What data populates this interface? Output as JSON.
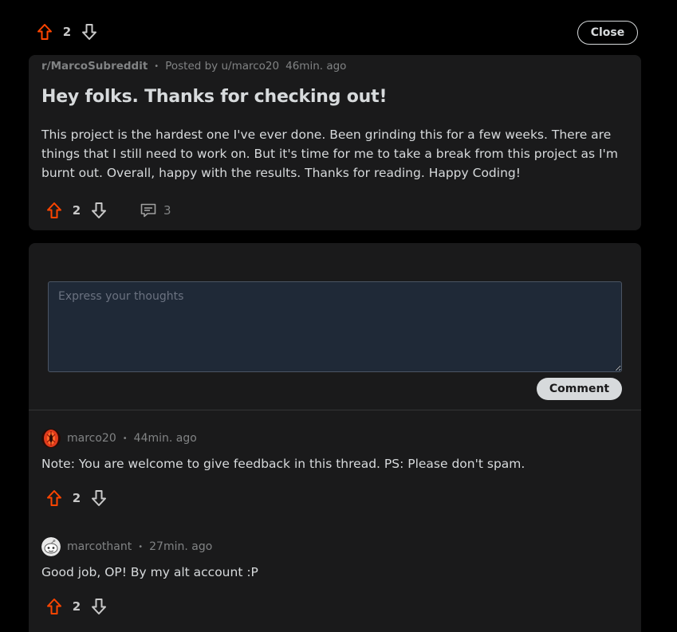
{
  "topbar": {
    "vote_count": "2",
    "close_label": "Close"
  },
  "post": {
    "subreddit": "r/MarcoSubreddit",
    "separator": "•",
    "posted_by": "Posted by u/marco20",
    "time": "46min. ago",
    "title": "Hey folks. Thanks for checking out!",
    "body": "This project is the hardest one I've ever done. Been grinding this for a few weeks. There are things that I still need to work on. But it's time for me to take a break from this project as I'm burnt out. Overall, happy with the results. Thanks for reading. Happy Coding!",
    "vote_count": "2",
    "comment_count": "3"
  },
  "comment_form": {
    "placeholder": "Express your thoughts",
    "value": "",
    "submit_label": "Comment"
  },
  "comments": [
    {
      "author": "marco20",
      "separator": "•",
      "time": "44min. ago",
      "text": "Note: You are welcome to give feedback in this thread. PS: Please don't spam.",
      "vote_count": "2",
      "avatar_icon": "red-avatar-icon"
    },
    {
      "author": "marcothant",
      "separator": "•",
      "time": "27min. ago",
      "text": "Good job, OP! By my alt account :P",
      "vote_count": "2",
      "avatar_icon": "snoo-avatar-icon"
    }
  ],
  "colors": {
    "background": "#000000",
    "card": "#1a1a1b",
    "upvote": "#ff4500",
    "text": "#d7dadc",
    "muted": "#818384",
    "input_bg": "#1f2937"
  }
}
